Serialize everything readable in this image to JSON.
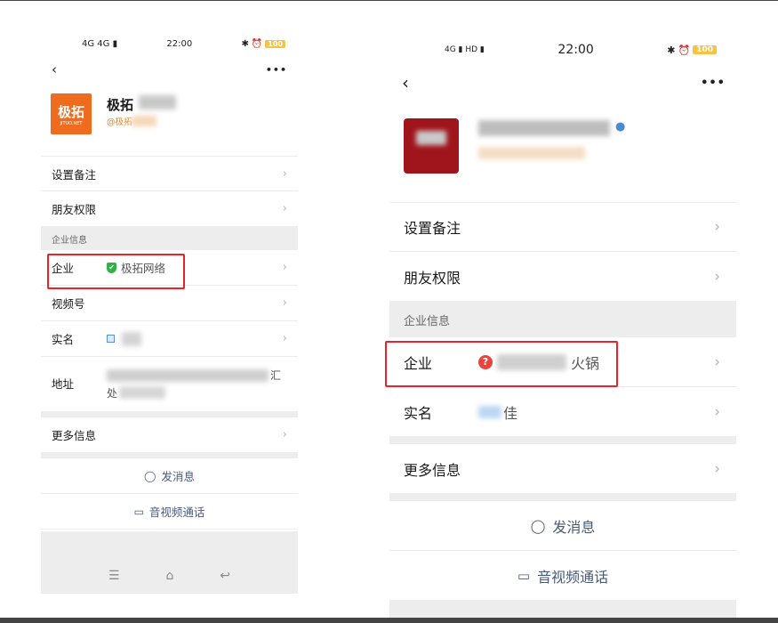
{
  "left": {
    "status": {
      "signals": "4G 4G ▮",
      "time": "22:00",
      "battery": "100"
    },
    "nav": {
      "back": "‹",
      "more": "•••"
    },
    "profile": {
      "name": "极拓",
      "sub": "@极拓",
      "logo_text": "极拓",
      "logo_sub": "JITUO.NET"
    },
    "rows": {
      "remark": "设置备注",
      "permission": "朋友权限",
      "section": "企业信息",
      "enterprise": "企业",
      "enterprise_value": "极拓网络",
      "channel": "视频号",
      "realname": "实名",
      "address": "地址",
      "address_tail": "汇",
      "address_line2": "处",
      "more_info": "更多信息"
    },
    "actions": {
      "message": "发消息",
      "call": "音视频通话"
    },
    "homebar": {
      "menu": "☰",
      "home": "⌂",
      "back": "↩"
    }
  },
  "right": {
    "status": {
      "signals": "4G ▮ HD ▮",
      "time": "22:00",
      "battery": "100"
    },
    "nav": {
      "back": "‹",
      "more": "•••"
    },
    "rows": {
      "remark": "设置备注",
      "permission": "朋友权限",
      "section": "企业信息",
      "enterprise": "企业",
      "enterprise_value": "火锅",
      "realname": "实名",
      "realname_value": "佳",
      "more_info": "更多信息"
    },
    "actions": {
      "message": "发消息",
      "call": "音视频通话"
    }
  },
  "icons": {
    "chevron": "›",
    "chat": "◯",
    "video": "▭",
    "verified": "✔",
    "question": "?"
  },
  "colors": {
    "highlight": "#e8232a",
    "accent_logo": "#ef6c1f",
    "verified": "#2fb344",
    "warning": "#e8453c"
  }
}
